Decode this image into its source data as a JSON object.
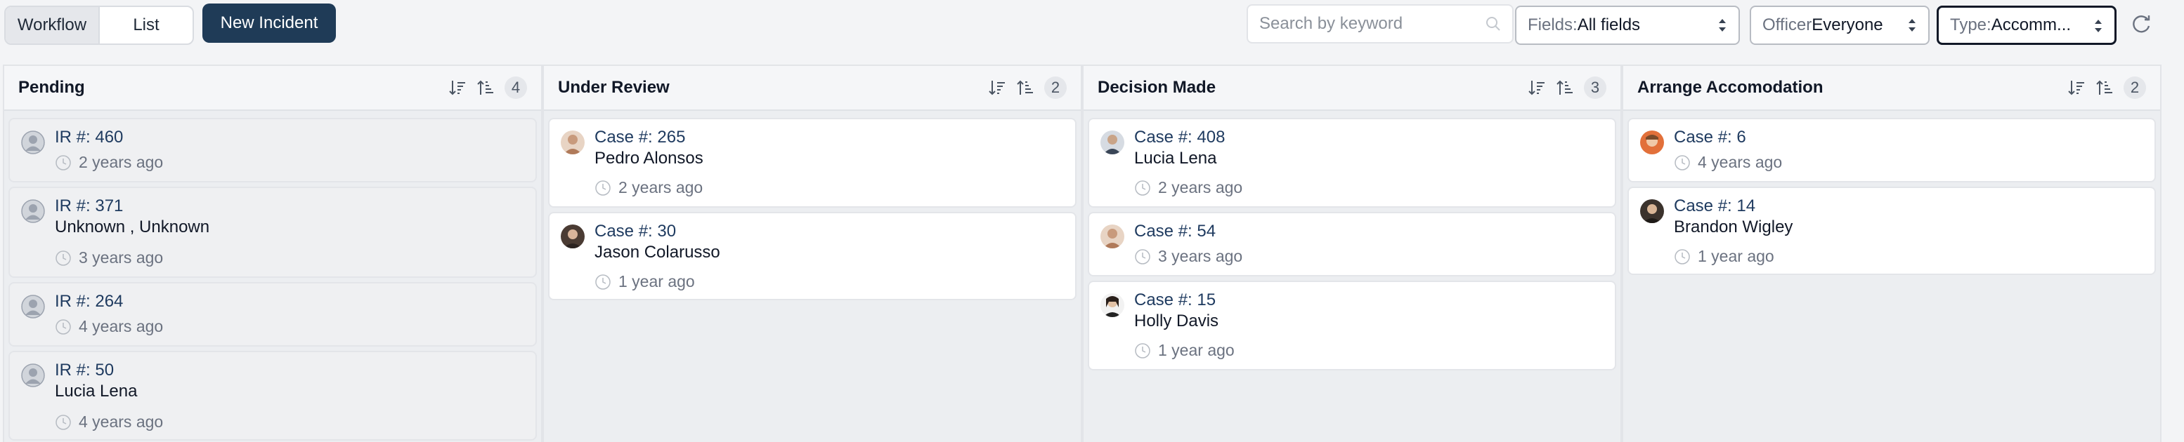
{
  "toolbar": {
    "view_tabs": [
      "Workflow",
      "List"
    ],
    "new_button": "New Incident",
    "search_placeholder": "Search by keyword",
    "fields_label": "Fields:",
    "fields_value": "All fields",
    "officer_label": "Officer",
    "officer_value": "Everyone",
    "type_label": "Type:",
    "type_value": "Accomm..."
  },
  "columns": [
    {
      "title": "Pending",
      "count": "4",
      "cards": [
        {
          "id": "IR #: 460",
          "name": "",
          "time": "2 years ago"
        },
        {
          "id": "IR #: 371",
          "name": "Unknown , Unknown",
          "time": "3 years ago"
        },
        {
          "id": "IR #: 264",
          "name": "",
          "time": "4 years ago"
        },
        {
          "id": "IR #: 50",
          "name": "Lucia Lena",
          "time": "4 years ago"
        }
      ]
    },
    {
      "title": "Under Review",
      "count": "2",
      "cards": [
        {
          "id": "Case #: 265",
          "name": "Pedro Alonsos",
          "time": "2 years ago"
        },
        {
          "id": "Case #: 30",
          "name": "Jason Colarusso",
          "time": "1 year ago"
        }
      ]
    },
    {
      "title": "Decision Made",
      "count": "3",
      "cards": [
        {
          "id": "Case #: 408",
          "name": "Lucia Lena",
          "time": "2 years ago"
        },
        {
          "id": "Case #: 54",
          "name": "",
          "time": "3 years ago"
        },
        {
          "id": "Case #: 15",
          "name": "Holly Davis",
          "time": "1 year ago"
        }
      ]
    },
    {
      "title": "Arrange Accomodation",
      "count": "2",
      "cards": [
        {
          "id": "Case #: 6",
          "name": "",
          "time": "4 years ago"
        },
        {
          "id": "Case #: 14",
          "name": "Brandon Wigley",
          "time": "1 year ago"
        }
      ]
    }
  ]
}
